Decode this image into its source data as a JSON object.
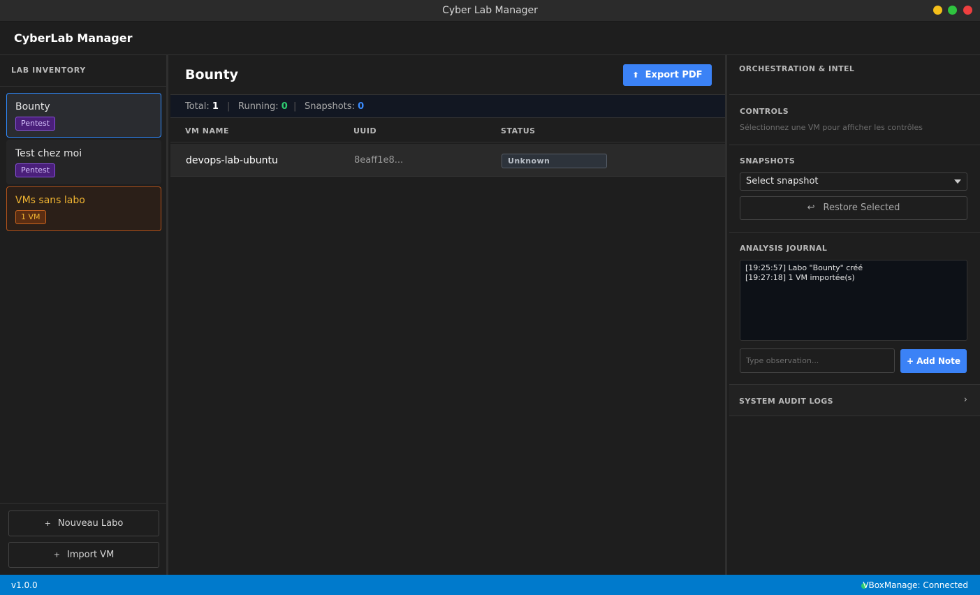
{
  "window": {
    "title": "Cyber Lab Manager"
  },
  "app": {
    "title": "CyberLab Manager"
  },
  "sidebar": {
    "section_title": "LAB INVENTORY",
    "labs": [
      {
        "name": "Bounty",
        "tag": "Pentest"
      },
      {
        "name": "Test chez moi",
        "tag": "Pentest"
      },
      {
        "name": "VMs sans labo",
        "tag": "1 VM"
      }
    ],
    "new_lab_label": "Nouveau Labo",
    "import_vm_label": "Import VM"
  },
  "main": {
    "lab_title": "Bounty",
    "export_label": "Export PDF",
    "stats": {
      "total_label": "Total:",
      "total_value": "1",
      "running_label": "Running:",
      "running_value": "0",
      "snapshots_label": "Snapshots:",
      "snapshots_value": "0"
    },
    "columns": [
      "VM NAME",
      "UUID",
      "STATUS"
    ],
    "rows": [
      {
        "name": "devops-lab-ubuntu",
        "uuid": "8eaff1e8...",
        "status": "Unknown"
      }
    ]
  },
  "right": {
    "title": "ORCHESTRATION & INTEL",
    "controls_title": "CONTROLS",
    "controls_hint": "Sélectionnez une VM pour afficher les contrôles",
    "snapshots_title": "SNAPSHOTS",
    "snapshot_select": "Select snapshot",
    "restore_label": "Restore Selected",
    "journal_title": "ANALYSIS JOURNAL",
    "journal_lines": [
      "[19:25:57] Labo \"Bounty\" créé",
      "[19:27:18] 1 VM importée(s)"
    ],
    "note_placeholder": "Type observation...",
    "add_note_label": "+ Add Note",
    "audit_title": "SYSTEM AUDIT LOGS"
  },
  "statusbar": {
    "version": "v1.0.0",
    "connection": "VBoxManage: Connected"
  },
  "colors": {
    "accent": "#3b82f6",
    "statusbar": "#007acc",
    "running": "#2ecc71",
    "snapshots": "#3b8cff",
    "orphan": "#f0b432"
  }
}
